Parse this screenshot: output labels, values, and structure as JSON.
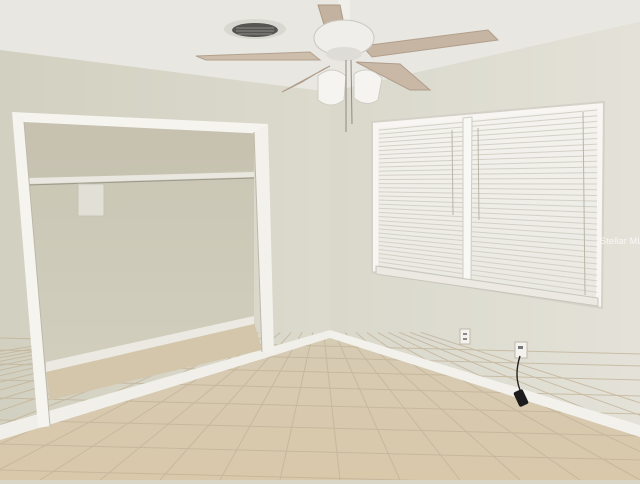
{
  "photo": {
    "subject": "empty-bedroom-interior",
    "watermark": "Stellar MLS",
    "colors": {
      "ceiling": "#e9e8e2",
      "left_wall": "#d8d6c7",
      "right_wall": "#dedcd0",
      "closet_interior": "#cfcbba",
      "trim": "#f4f3ee",
      "floor_tile": "#d8cbb2",
      "grout": "#c2b398",
      "blinds": "#f1f0ea",
      "fan_blade": "#c9b8a6"
    },
    "icons": {
      "ceiling_fan": "ceiling-fan-icon",
      "air_vent": "air-vent-icon",
      "outlet": "wall-outlet-icon"
    }
  }
}
